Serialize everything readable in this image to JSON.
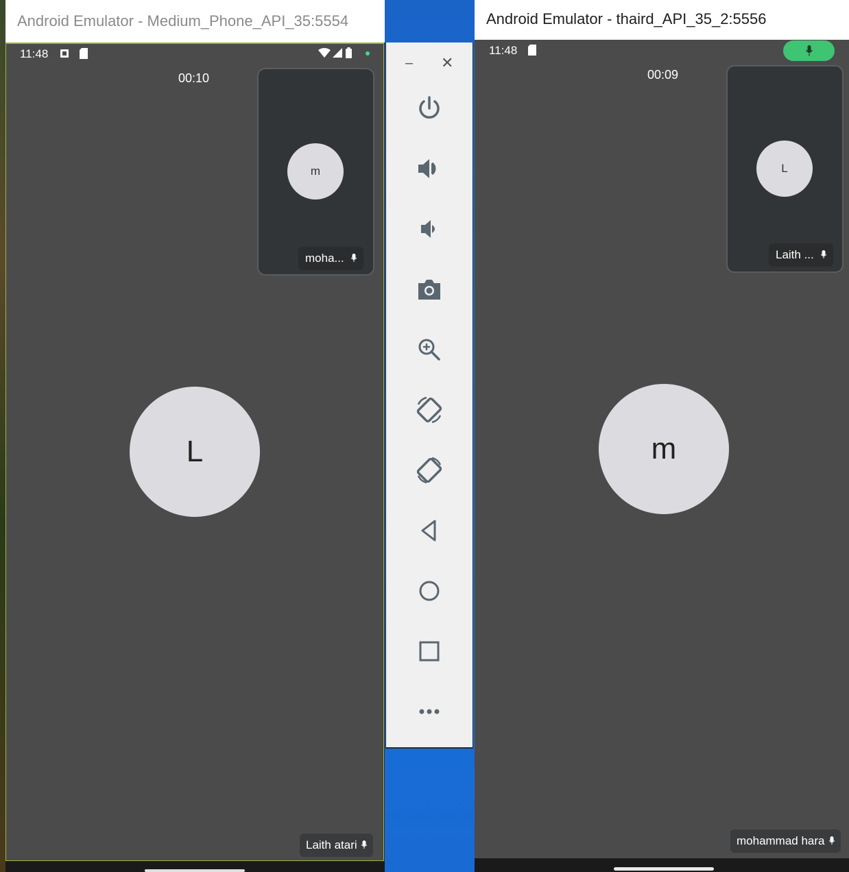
{
  "left_window": {
    "title": "Android Emulator - Medium_Phone_API_35:5554",
    "status_time": "11:48",
    "call_timer": "00:10",
    "pip": {
      "avatar_initial": "m",
      "name": "moha..."
    },
    "main_avatar_initial": "L",
    "main_name": "Laith atari"
  },
  "right_window": {
    "title": "Android Emulator - thaird_API_35_2:5556",
    "status_time": "11:48",
    "call_timer": "00:09",
    "pip": {
      "avatar_initial": "L",
      "name": "Laith ..."
    },
    "main_avatar_initial": "m",
    "main_name": "mohammad hara"
  },
  "toolbar": {
    "minimize": "–",
    "close": "✕",
    "buttons": [
      "power-icon",
      "volume-up-icon",
      "volume-down-icon",
      "camera-icon",
      "zoom-icon",
      "rotate-left-icon",
      "rotate-right-icon",
      "back-icon",
      "home-icon",
      "overview-icon",
      "more-icon"
    ]
  },
  "colors": {
    "call_background": "#4b4b4c",
    "avatar": "#dcdce0",
    "mic_active": "#3ec472",
    "toolbar_icon": "#5a6770"
  }
}
